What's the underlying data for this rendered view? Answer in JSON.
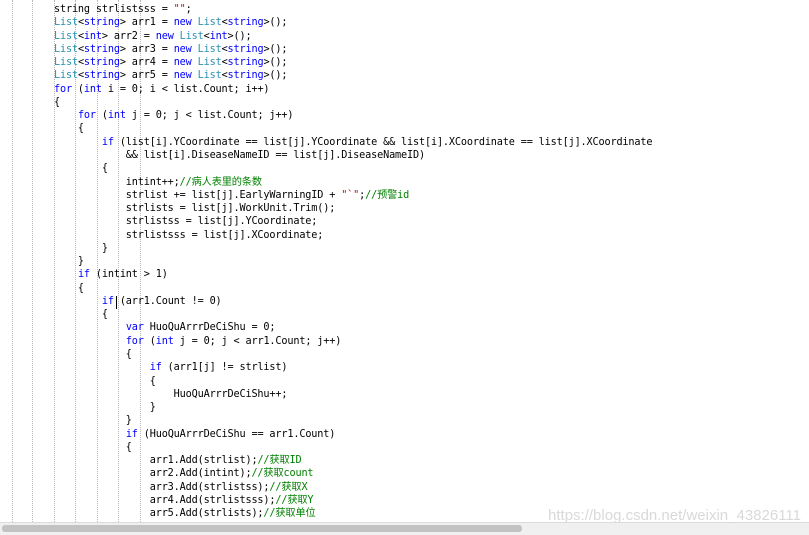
{
  "editor": {
    "lines": [
      [
        [
          "",
          "string strlistsss = "
        ],
        [
          "st",
          "\"\""
        ],
        [
          "",
          ";"
        ]
      ],
      [
        [
          "ty",
          "List"
        ],
        [
          "",
          "<"
        ],
        [
          "kw",
          "string"
        ],
        [
          "",
          "> arr1 = "
        ],
        [
          "kw",
          "new"
        ],
        [
          "ty",
          " List"
        ],
        [
          "",
          "<"
        ],
        [
          "kw",
          "string"
        ],
        [
          "",
          ">();"
        ]
      ],
      [
        [
          "ty",
          "List"
        ],
        [
          "",
          "<"
        ],
        [
          "kw",
          "int"
        ],
        [
          "",
          "> arr2 = "
        ],
        [
          "kw",
          "new"
        ],
        [
          "ty",
          " List"
        ],
        [
          "",
          "<"
        ],
        [
          "kw",
          "int"
        ],
        [
          "",
          ">();"
        ]
      ],
      [
        [
          "ty",
          "List"
        ],
        [
          "",
          "<"
        ],
        [
          "kw",
          "string"
        ],
        [
          "",
          "> arr3 = "
        ],
        [
          "kw",
          "new"
        ],
        [
          "ty",
          " List"
        ],
        [
          "",
          "<"
        ],
        [
          "kw",
          "string"
        ],
        [
          "",
          ">();"
        ]
      ],
      [
        [
          "ty",
          "List"
        ],
        [
          "",
          "<"
        ],
        [
          "kw",
          "string"
        ],
        [
          "",
          "> arr4 = "
        ],
        [
          "kw",
          "new"
        ],
        [
          "ty",
          " List"
        ],
        [
          "",
          "<"
        ],
        [
          "kw",
          "string"
        ],
        [
          "",
          ">();"
        ]
      ],
      [
        [
          "ty",
          "List"
        ],
        [
          "",
          "<"
        ],
        [
          "kw",
          "string"
        ],
        [
          "",
          "> arr5 = "
        ],
        [
          "kw",
          "new"
        ],
        [
          "ty",
          " List"
        ],
        [
          "",
          "<"
        ],
        [
          "kw",
          "string"
        ],
        [
          "",
          ">();"
        ]
      ],
      [
        [
          "kw",
          "for"
        ],
        [
          "",
          " ("
        ],
        [
          "kw",
          "int"
        ],
        [
          "",
          " i = 0; i < list.Count; i++)"
        ]
      ],
      [
        [
          "",
          "{"
        ]
      ],
      [
        [
          "",
          "    "
        ],
        [
          "kw",
          "for"
        ],
        [
          "",
          " ("
        ],
        [
          "kw",
          "int"
        ],
        [
          "",
          " j = 0; j < list.Count; j++)"
        ]
      ],
      [
        [
          "",
          "    {"
        ]
      ],
      [
        [
          "",
          "        "
        ],
        [
          "kw",
          "if"
        ],
        [
          "",
          " (list[i].YCoordinate == list[j].YCoordinate && list[i].XCoordinate == list[j].XCoordinate"
        ]
      ],
      [
        [
          "",
          "            && list[i].DiseaseNameID == list[j].DiseaseNameID)"
        ]
      ],
      [
        [
          "",
          "        {"
        ]
      ],
      [
        [
          "",
          "            intint++;"
        ],
        [
          "cm",
          "//病人表里的条数"
        ]
      ],
      [
        [
          "",
          "            strlist += list[j].EarlyWarningID + "
        ],
        [
          "st",
          "\"`\""
        ],
        [
          "",
          ";"
        ],
        [
          "cm",
          "//预警id"
        ]
      ],
      [
        [
          "",
          "            strlists = list[j].WorkUnit.Trim();"
        ]
      ],
      [
        [
          "",
          "            strlistss = list[j].YCoordinate;"
        ]
      ],
      [
        [
          "",
          "            strlistsss = list[j].XCoordinate;"
        ]
      ],
      [
        [
          "",
          "        }"
        ]
      ],
      [
        [
          "",
          "    }"
        ]
      ],
      [
        [
          "",
          "    "
        ],
        [
          "kw",
          "if"
        ],
        [
          "",
          " (intint > 1)"
        ]
      ],
      [
        [
          "",
          "    {"
        ]
      ],
      [
        [
          "",
          "        "
        ],
        [
          "kw",
          "if"
        ],
        [
          "",
          " (arr1.Count != 0)"
        ]
      ],
      [
        [
          "",
          "        {"
        ]
      ],
      [
        [
          "",
          "            "
        ],
        [
          "kw",
          "var"
        ],
        [
          "",
          " HuoQuArrrDeCiShu = 0;"
        ]
      ],
      [
        [
          "",
          "            "
        ],
        [
          "kw",
          "for"
        ],
        [
          "",
          " ("
        ],
        [
          "kw",
          "int"
        ],
        [
          "",
          " j = 0; j < arr1.Count; j++)"
        ]
      ],
      [
        [
          "",
          "            {"
        ]
      ],
      [
        [
          "",
          "                "
        ],
        [
          "kw",
          "if"
        ],
        [
          "",
          " (arr1[j] != strlist)"
        ]
      ],
      [
        [
          "",
          "                {"
        ]
      ],
      [
        [
          "",
          "                    HuoQuArrrDeCiShu++;"
        ]
      ],
      [
        [
          "",
          "                }"
        ]
      ],
      [
        [
          "",
          "            }"
        ]
      ],
      [
        [
          "",
          "            "
        ],
        [
          "kw",
          "if"
        ],
        [
          "",
          " (HuoQuArrrDeCiShu == arr1.Count)"
        ]
      ],
      [
        [
          "",
          "            {"
        ]
      ],
      [
        [
          "",
          "                arr1.Add(strlist);"
        ],
        [
          "cm",
          "//获取ID"
        ]
      ],
      [
        [
          "",
          "                arr2.Add(intint);"
        ],
        [
          "cm",
          "//获取count"
        ]
      ],
      [
        [
          "",
          "                arr3.Add(strlistss);"
        ],
        [
          "cm",
          "//获取X"
        ]
      ],
      [
        [
          "",
          "                arr4.Add(strlistsss);"
        ],
        [
          "cm",
          "//获取Y"
        ]
      ],
      [
        [
          "",
          "                arr5.Add(strlists);"
        ],
        [
          "cm",
          "//获取单位"
        ]
      ]
    ]
  },
  "watermark": "https://blog.csdn.net/weixin_43826111"
}
